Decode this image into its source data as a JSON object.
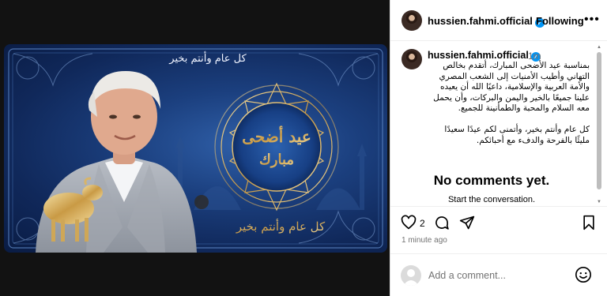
{
  "post_image": {
    "banner_top_text": "كل عام وأنتم بخير",
    "center_line_1": "عيد أضحى",
    "center_line_2": "مبارك",
    "banner_bottom_text": "كل عام وأنتم بخير"
  },
  "header": {
    "username": "hussien.fahmi.official",
    "follow_label": "Following",
    "more_label": "•••"
  },
  "caption": {
    "username": "hussien.fahmi.official",
    "time": "1m",
    "paragraph_1": "بمناسبة عيد الأضحى المبارك، أتقدم بخالص التهاني وأطيب الأمنيات إلى الشعب المصري والأمة العربية والإسلامية، داعيًا الله أن يعيده علينا جميعًا بالخير واليمن والبركات، وأن يحمل معه السلام والمحبة والطمأنينة للجميع.",
    "paragraph_2": "كل عام وأنتم بخير، وأتمنى لكم عيدًا سعيدًا مليئًا بالفرحة والدفء مع أحبائكم."
  },
  "comments": {
    "empty_title": "No comments yet.",
    "empty_subtitle": "Start the conversation."
  },
  "actions": {
    "like_count": "2",
    "time_ago": "1 minute ago"
  },
  "comment_box": {
    "placeholder": "Add a comment..."
  },
  "colors": {
    "verified": "#0095f6",
    "banner_blue": "#1b3f7e",
    "gold": "#d7b46a"
  }
}
